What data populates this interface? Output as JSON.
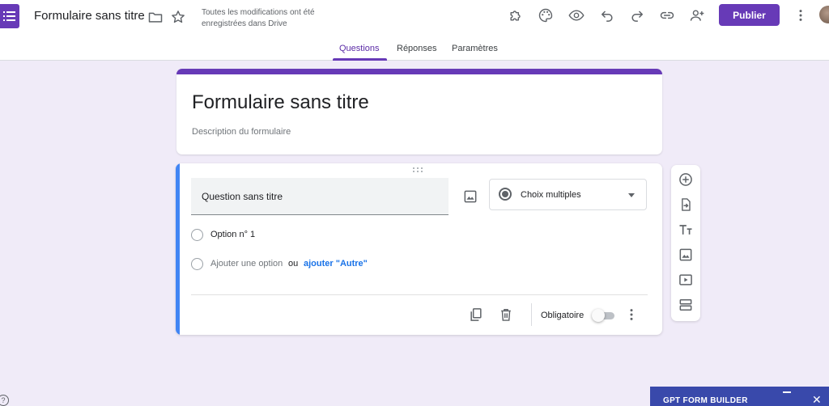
{
  "header": {
    "doc_title": "Formulaire sans titre",
    "save_status": "Toutes les modifications ont été enregistrées dans Drive",
    "publish_label": "Publier",
    "icons": [
      "forms-app-icon",
      "folder-icon",
      "star-icon",
      "addon-puzzle-icon",
      "palette-icon",
      "preview-eye-icon",
      "undo-icon",
      "redo-icon",
      "link-icon",
      "add-collaborator-icon",
      "more-vert-icon",
      "avatar"
    ]
  },
  "tabs": [
    {
      "label": "Questions",
      "active": true
    },
    {
      "label": "Réponses",
      "active": false
    },
    {
      "label": "Paramètres",
      "active": false
    }
  ],
  "form": {
    "title": "Formulaire sans titre",
    "description_placeholder": "Description du formulaire"
  },
  "question": {
    "title": "Question sans titre",
    "type": "Choix multiples",
    "options": [
      "Option n° 1"
    ],
    "add_option": "Ajouter une option",
    "or": "ou",
    "add_other": "ajouter \"Autre\"",
    "required_label": "Obligatoire",
    "required": false
  },
  "side_toolbar": [
    "add-question-icon",
    "import-questions-icon",
    "add-title-text-icon",
    "add-image-icon",
    "add-video-icon",
    "add-section-icon"
  ],
  "gpt_panel": {
    "title": "GPT FORM BUILDER"
  },
  "colors": {
    "accent": "#673ab7",
    "background": "#f0ebf8",
    "focus_bar": "#4285f4",
    "link": "#1a73e8",
    "gpt_panel": "#3949ab"
  }
}
